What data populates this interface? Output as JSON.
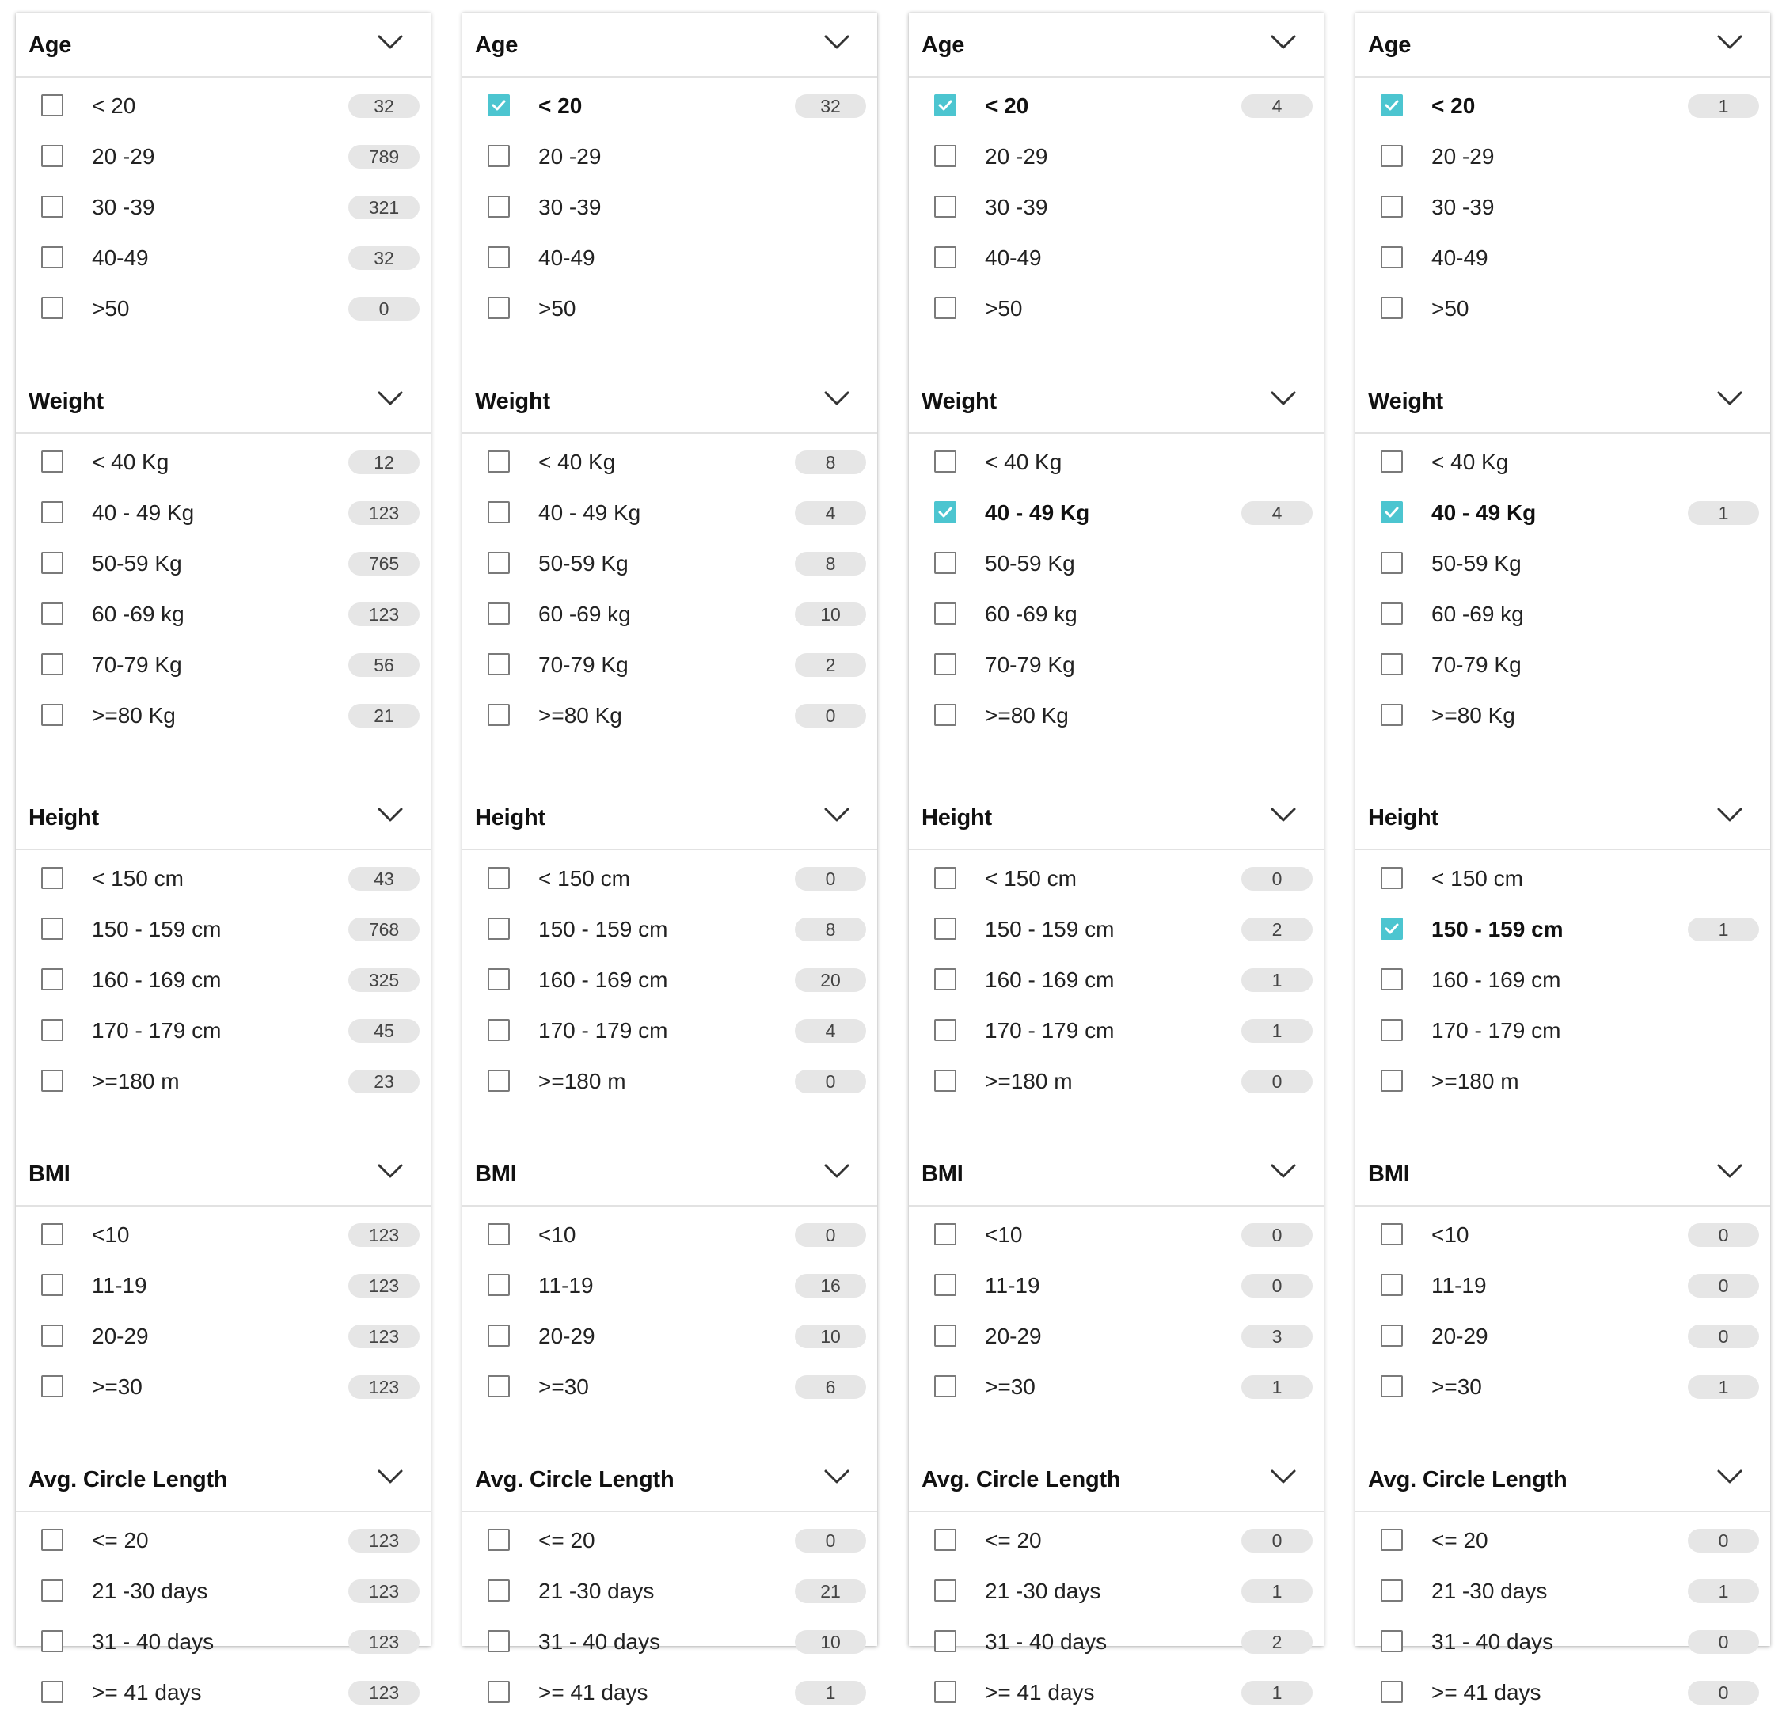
{
  "panels": [
    {
      "sections": [
        {
          "title": "Age",
          "icon": "chevron-down-icon",
          "items": [
            {
              "label": "< 20",
              "count": "32",
              "checked": false
            },
            {
              "label": "20 -29",
              "count": "789",
              "checked": false
            },
            {
              "label": "30 -39",
              "count": "321",
              "checked": false
            },
            {
              "label": "40-49",
              "count": "32",
              "checked": false
            },
            {
              "label": ">50",
              "count": "0",
              "checked": false
            }
          ]
        },
        {
          "title": "Weight",
          "icon": "chevron-down-icon",
          "items": [
            {
              "label": "< 40 Kg",
              "count": "12",
              "checked": false
            },
            {
              "label": "40 - 49 Kg",
              "count": "123",
              "checked": false
            },
            {
              "label": "50-59 Kg",
              "count": "765",
              "checked": false
            },
            {
              "label": "60 -69 kg",
              "count": "123",
              "checked": false
            },
            {
              "label": "70-79 Kg",
              "count": "56",
              "checked": false
            },
            {
              "label": ">=80 Kg",
              "count": "21",
              "checked": false
            }
          ]
        },
        {
          "title": "Height",
          "icon": "chevron-down-icon",
          "items": [
            {
              "label": "< 150 cm",
              "count": "43",
              "checked": false
            },
            {
              "label": "150 - 159 cm",
              "count": "768",
              "checked": false
            },
            {
              "label": "160 - 169 cm",
              "count": "325",
              "checked": false
            },
            {
              "label": "170 - 179 cm",
              "count": "45",
              "checked": false
            },
            {
              "label": ">=180 m",
              "count": "23",
              "checked": false
            }
          ]
        },
        {
          "title": "BMI",
          "icon": "chevron-down-icon",
          "items": [
            {
              "label": "<10",
              "count": "123",
              "checked": false
            },
            {
              "label": "11-19",
              "count": "123",
              "checked": false
            },
            {
              "label": "20-29",
              "count": "123",
              "checked": false
            },
            {
              "label": ">=30",
              "count": "123",
              "checked": false
            }
          ]
        },
        {
          "title": "Avg. Circle Length",
          "icon": "chevron-down-icon",
          "items": [
            {
              "label": "<= 20",
              "count": "123",
              "checked": false
            },
            {
              "label": "21 -30 days",
              "count": "123",
              "checked": false
            },
            {
              "label": "31 - 40 days",
              "count": "123",
              "checked": false
            },
            {
              "label": ">= 41 days",
              "count": "123",
              "checked": false
            }
          ]
        }
      ]
    },
    {
      "sections": [
        {
          "title": "Age",
          "icon": "chevron-down-icon",
          "items": [
            {
              "label": "< 20",
              "count": "32",
              "checked": true
            },
            {
              "label": "20 -29",
              "count": null,
              "checked": false
            },
            {
              "label": "30 -39",
              "count": null,
              "checked": false
            },
            {
              "label": "40-49",
              "count": null,
              "checked": false
            },
            {
              "label": ">50",
              "count": null,
              "checked": false
            }
          ]
        },
        {
          "title": "Weight",
          "icon": "chevron-down-icon",
          "items": [
            {
              "label": "< 40 Kg",
              "count": "8",
              "checked": false
            },
            {
              "label": "40 - 49 Kg",
              "count": "4",
              "checked": false
            },
            {
              "label": "50-59 Kg",
              "count": "8",
              "checked": false
            },
            {
              "label": "60 -69 kg",
              "count": "10",
              "checked": false
            },
            {
              "label": "70-79 Kg",
              "count": "2",
              "checked": false
            },
            {
              "label": ">=80 Kg",
              "count": "0",
              "checked": false
            }
          ]
        },
        {
          "title": "Height",
          "icon": "chevron-down-icon",
          "items": [
            {
              "label": "< 150 cm",
              "count": "0",
              "checked": false
            },
            {
              "label": "150 - 159 cm",
              "count": "8",
              "checked": false
            },
            {
              "label": "160 - 169 cm",
              "count": "20",
              "checked": false
            },
            {
              "label": "170 - 179 cm",
              "count": "4",
              "checked": false
            },
            {
              "label": ">=180 m",
              "count": "0",
              "checked": false
            }
          ]
        },
        {
          "title": "BMI",
          "icon": "chevron-down-icon",
          "items": [
            {
              "label": "<10",
              "count": "0",
              "checked": false
            },
            {
              "label": "11-19",
              "count": "16",
              "checked": false
            },
            {
              "label": "20-29",
              "count": "10",
              "checked": false
            },
            {
              "label": ">=30",
              "count": "6",
              "checked": false
            }
          ]
        },
        {
          "title": "Avg. Circle Length",
          "icon": "chevron-down-icon",
          "items": [
            {
              "label": "<= 20",
              "count": "0",
              "checked": false
            },
            {
              "label": "21 -30 days",
              "count": "21",
              "checked": false
            },
            {
              "label": "31 - 40 days",
              "count": "10",
              "checked": false
            },
            {
              "label": ">= 41 days",
              "count": "1",
              "checked": false
            }
          ]
        }
      ]
    },
    {
      "sections": [
        {
          "title": "Age",
          "icon": "chevron-down-icon",
          "items": [
            {
              "label": "< 20",
              "count": "4",
              "checked": true
            },
            {
              "label": "20 -29",
              "count": null,
              "checked": false
            },
            {
              "label": "30 -39",
              "count": null,
              "checked": false
            },
            {
              "label": "40-49",
              "count": null,
              "checked": false
            },
            {
              "label": ">50",
              "count": null,
              "checked": false
            }
          ]
        },
        {
          "title": "Weight",
          "icon": "chevron-down-icon",
          "items": [
            {
              "label": "< 40 Kg",
              "count": null,
              "checked": false
            },
            {
              "label": "40 - 49 Kg",
              "count": "4",
              "checked": true
            },
            {
              "label": "50-59 Kg",
              "count": null,
              "checked": false
            },
            {
              "label": "60 -69 kg",
              "count": null,
              "checked": false
            },
            {
              "label": "70-79 Kg",
              "count": null,
              "checked": false
            },
            {
              "label": ">=80 Kg",
              "count": null,
              "checked": false
            }
          ]
        },
        {
          "title": "Height",
          "icon": "chevron-down-icon",
          "items": [
            {
              "label": "< 150 cm",
              "count": "0",
              "checked": false
            },
            {
              "label": "150 - 159 cm",
              "count": "2",
              "checked": false
            },
            {
              "label": "160 - 169 cm",
              "count": "1",
              "checked": false
            },
            {
              "label": "170 - 179 cm",
              "count": "1",
              "checked": false
            },
            {
              "label": ">=180 m",
              "count": "0",
              "checked": false
            }
          ]
        },
        {
          "title": "BMI",
          "icon": "chevron-down-icon",
          "items": [
            {
              "label": "<10",
              "count": "0",
              "checked": false
            },
            {
              "label": "11-19",
              "count": "0",
              "checked": false
            },
            {
              "label": "20-29",
              "count": "3",
              "checked": false
            },
            {
              "label": ">=30",
              "count": "1",
              "checked": false
            }
          ]
        },
        {
          "title": "Avg. Circle Length",
          "icon": "chevron-down-icon",
          "items": [
            {
              "label": "<= 20",
              "count": "0",
              "checked": false
            },
            {
              "label": "21 -30 days",
              "count": "1",
              "checked": false
            },
            {
              "label": "31 - 40 days",
              "count": "2",
              "checked": false
            },
            {
              "label": ">= 41 days",
              "count": "1",
              "checked": false
            }
          ]
        }
      ]
    },
    {
      "sections": [
        {
          "title": "Age",
          "icon": "chevron-down-icon",
          "items": [
            {
              "label": "< 20",
              "count": "1",
              "checked": true
            },
            {
              "label": "20 -29",
              "count": null,
              "checked": false
            },
            {
              "label": "30 -39",
              "count": null,
              "checked": false
            },
            {
              "label": "40-49",
              "count": null,
              "checked": false
            },
            {
              "label": ">50",
              "count": null,
              "checked": false
            }
          ]
        },
        {
          "title": "Weight",
          "icon": "chevron-down-icon",
          "items": [
            {
              "label": "< 40 Kg",
              "count": null,
              "checked": false
            },
            {
              "label": "40 - 49 Kg",
              "count": "1",
              "checked": true
            },
            {
              "label": "50-59 Kg",
              "count": null,
              "checked": false
            },
            {
              "label": "60 -69 kg",
              "count": null,
              "checked": false
            },
            {
              "label": "70-79 Kg",
              "count": null,
              "checked": false
            },
            {
              "label": ">=80 Kg",
              "count": null,
              "checked": false
            }
          ]
        },
        {
          "title": "Height",
          "icon": "chevron-down-icon",
          "items": [
            {
              "label": "< 150 cm",
              "count": null,
              "checked": false
            },
            {
              "label": "150 - 159 cm",
              "count": "1",
              "checked": true
            },
            {
              "label": "160 - 169 cm",
              "count": null,
              "checked": false
            },
            {
              "label": "170 - 179 cm",
              "count": null,
              "checked": false
            },
            {
              "label": ">=180 m",
              "count": null,
              "checked": false
            }
          ]
        },
        {
          "title": "BMI",
          "icon": "chevron-down-icon",
          "items": [
            {
              "label": "<10",
              "count": "0",
              "checked": false
            },
            {
              "label": "11-19",
              "count": "0",
              "checked": false
            },
            {
              "label": "20-29",
              "count": "0",
              "checked": false
            },
            {
              "label": ">=30",
              "count": "1",
              "checked": false
            }
          ]
        },
        {
          "title": "Avg. Circle Length",
          "icon": "chevron-down-icon",
          "items": [
            {
              "label": "<= 20",
              "count": "0",
              "checked": false
            },
            {
              "label": "21 -30 days",
              "count": "1",
              "checked": false
            },
            {
              "label": "31 - 40 days",
              "count": "0",
              "checked": false
            },
            {
              "label": ">= 41 days",
              "count": "0",
              "checked": false
            }
          ]
        }
      ]
    }
  ],
  "colors": {
    "checkbox_checked": "#4cc5d0",
    "badge_bg": "#e6e6e6",
    "divider": "#e2e2e2"
  }
}
